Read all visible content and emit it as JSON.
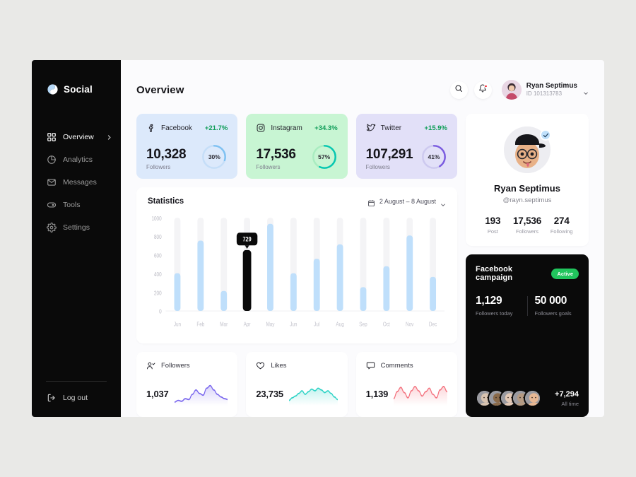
{
  "theme": {
    "page_bg": "#e9e9e7",
    "panel_bg": "#fbfbfd",
    "sidebar_bg": "#0a0a0a",
    "accent_blue": "#a8d4f7",
    "accent_green": "#21c55d",
    "danger": "#f5222d"
  },
  "sidebar": {
    "brand": "Social",
    "items": [
      {
        "label": "Overview",
        "icon": "grid-icon",
        "active": true,
        "chevron": true
      },
      {
        "label": "Analytics",
        "icon": "pie-chart-icon",
        "active": false,
        "chevron": false
      },
      {
        "label": "Messages",
        "icon": "envelope-icon",
        "active": false,
        "chevron": false
      },
      {
        "label": "Tools",
        "icon": "toggle-icon",
        "active": false,
        "chevron": false
      },
      {
        "label": "Settings",
        "icon": "gear-icon",
        "active": false,
        "chevron": false
      }
    ],
    "logout": "Log out"
  },
  "header": {
    "title": "Overview",
    "search_icon": "search-icon",
    "bell_icon": "bell-icon",
    "has_notification": true,
    "user_name": "Ryan Septimus",
    "user_id": "ID 101313783"
  },
  "social_cards": [
    {
      "network": "Facebook",
      "icon": "facebook-icon",
      "delta": "+21.7%",
      "value": "10,328",
      "sub": "Followers",
      "percent": 30,
      "percent_label": "30%",
      "bg": "#dce9fb",
      "ring": "#7fc1f2",
      "track": "#c5def8",
      "delta_color": "#0f9d58"
    },
    {
      "network": "Instagram",
      "icon": "instagram-icon",
      "delta": "+34.3%",
      "value": "17,536",
      "sub": "Followers",
      "percent": 57,
      "percent_label": "57%",
      "bg": "#c8f5d3",
      "ring": "#06c7b1",
      "track": "#a9ecc0",
      "delta_color": "#0f9d58"
    },
    {
      "network": "Twitter",
      "icon": "twitter-icon",
      "delta": "+15.9%",
      "value": "107,291",
      "sub": "Followers",
      "percent": 41,
      "percent_label": "41%",
      "bg": "#e2e0f8",
      "ring": "#7b5ce0",
      "track": "#cdc9ef",
      "delta_color": "#0f9d58"
    }
  ],
  "statistics": {
    "title": "Statistics",
    "calendar_icon": "calendar-icon",
    "date_range": "2 August  –  8 August",
    "chart_data": {
      "type": "bar",
      "title": "Statistics",
      "xlabel": "",
      "ylabel": "",
      "ylim": [
        0,
        1000
      ],
      "yticks": [
        0,
        200,
        400,
        600,
        800,
        1000
      ],
      "ytick_labels": [
        "0",
        "200",
        "400",
        "600",
        "800",
        "1000"
      ],
      "grid": false,
      "legend": "none",
      "categories": [
        "Jun",
        "Feb",
        "Mar",
        "Apr",
        "May",
        "Jun",
        "Jul",
        "Aug",
        "Sep",
        "Oct",
        "Nov",
        "Dec"
      ],
      "values": [
        405,
        755,
        215,
        640,
        935,
        405,
        560,
        715,
        255,
        480,
        810,
        365
      ],
      "track_max": 1000,
      "bar_color": "#bfdffb",
      "track_color": "#f4f4f6",
      "highlight_index": 3,
      "highlight_color": "#0a0a0a",
      "tooltip_value": "729"
    }
  },
  "metrics": [
    {
      "label": "Followers",
      "icon": "user-check-icon",
      "value": "1,037",
      "color": "#7b68ee",
      "points": [
        22,
        20,
        21,
        18,
        19,
        13,
        8,
        12,
        14,
        6,
        3,
        8,
        13,
        16,
        18,
        19
      ]
    },
    {
      "label": "Likes",
      "icon": "heart-icon",
      "value": "23,735",
      "color": "#2ed3c6",
      "points": [
        20,
        17,
        15,
        12,
        9,
        13,
        10,
        7,
        9,
        6,
        8,
        11,
        9,
        12,
        16,
        19
      ]
    },
    {
      "label": "Comments",
      "icon": "comment-icon",
      "value": "1,139",
      "color": "#f4737f",
      "points": [
        18,
        10,
        5,
        11,
        17,
        9,
        4,
        9,
        15,
        10,
        6,
        13,
        17,
        8,
        4,
        10
      ]
    }
  ],
  "profile": {
    "name": "Ryan Septimus",
    "handle": "@rayn.septimus",
    "verified": true,
    "verified_icon": "check-badge-icon",
    "stats": [
      {
        "value": "193",
        "label": "Post"
      },
      {
        "value": "17,536",
        "label": "Followers"
      },
      {
        "value": "274",
        "label": "Following"
      }
    ]
  },
  "campaign": {
    "title": "Facebook campaign",
    "status": "Active",
    "followers_today_value": "1,129",
    "followers_today_label": "Followers today",
    "followers_goal_value": "50 000",
    "followers_goal_label": "Followers goals",
    "all_time_value": "+7,294",
    "all_time_label": "All time",
    "avatar_count": 5,
    "avatar_colors": [
      "#d8c3b0",
      "#8a6a4a",
      "#e3c9b6",
      "#b59a82",
      "#e8b894"
    ]
  }
}
